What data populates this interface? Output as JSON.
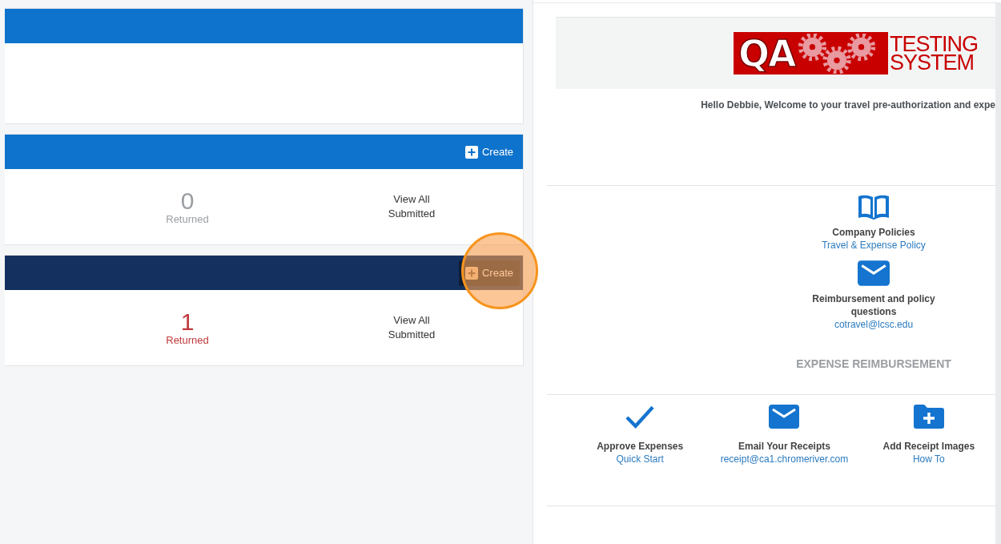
{
  "cards": [
    {
      "color": "#0e73cc"
    },
    {
      "color": "#0e73cc",
      "create": {
        "label": "Create",
        "highlighted": false
      },
      "stats": {
        "count": "0",
        "count_label": "Returned",
        "color": "#9a9ea3",
        "link": "View All\nSubmitted"
      }
    },
    {
      "color": "#13305f",
      "create": {
        "label": "Create",
        "highlighted": true
      },
      "stats": {
        "count": "1",
        "count_label": "Returned",
        "color": "#c0393b",
        "link": "View All\nSubmitted"
      }
    }
  ],
  "logo": {
    "mark": "QA",
    "line1": "TESTING",
    "line2": "SYSTEM"
  },
  "greeting": "Hello Debbie, Welcome to your travel pre-authorization and expe",
  "contacts": [
    {
      "kind": "book",
      "title": "Company Policies",
      "link": "Travel & Expense Policy"
    },
    {
      "kind": "mail",
      "title": "Reimbursement and policy\nquestions",
      "link": "cotravel@lcsc.edu"
    }
  ],
  "section_title": "EXPENSE REIMBURSEMENT",
  "actions": [
    {
      "kind": "check",
      "title": "Approve Expenses",
      "link": "Quick Start"
    },
    {
      "kind": "mail",
      "title": "Email Your Receipts",
      "link": "receipt@ca1.chromeriver.com"
    },
    {
      "kind": "folder",
      "title": "Add Receipt Images",
      "link": "How To"
    }
  ]
}
